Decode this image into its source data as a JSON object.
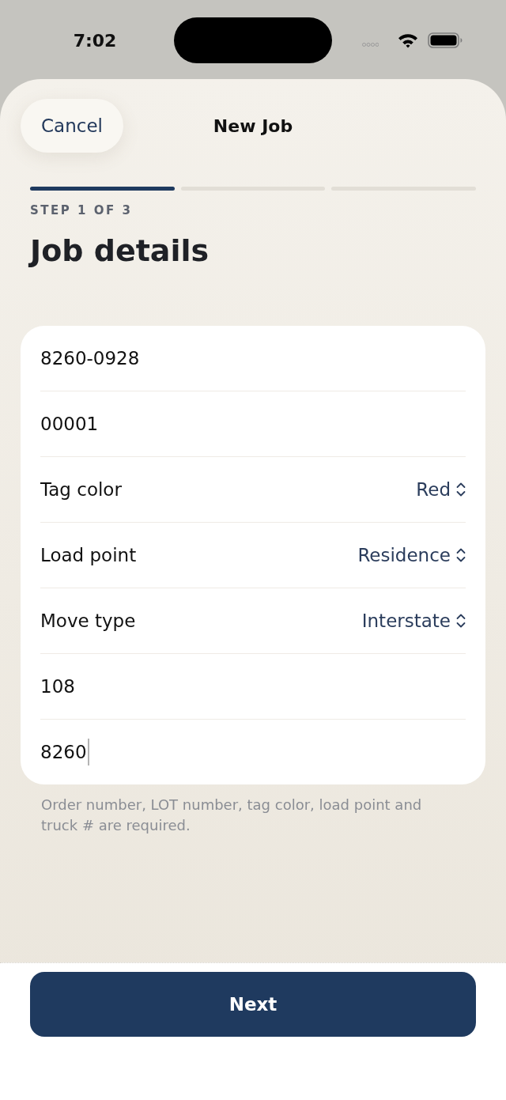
{
  "status_bar": {
    "time": "7:02"
  },
  "nav": {
    "cancel": "Cancel",
    "title": "New Job"
  },
  "progress": {
    "segments": [
      {
        "complete": true
      },
      {
        "complete": false
      },
      {
        "complete": false
      }
    ]
  },
  "step_label": "STEP 1 OF 3",
  "heading": "Job details",
  "form": {
    "rows": [
      {
        "kind": "text",
        "value": "8260-0928",
        "focused": false
      },
      {
        "kind": "text",
        "value": "00001",
        "focused": false
      },
      {
        "kind": "picker",
        "label": "Tag color",
        "value": "Red"
      },
      {
        "kind": "picker",
        "label": "Load point",
        "value": "Residence"
      },
      {
        "kind": "picker",
        "label": "Move type",
        "value": "Interstate"
      },
      {
        "kind": "text",
        "value": "108",
        "focused": false
      },
      {
        "kind": "text",
        "value": "8260",
        "focused": true
      }
    ]
  },
  "footnote": "Order number, LOT number, tag color, load point and truck # are required.",
  "next_button": "Next"
}
